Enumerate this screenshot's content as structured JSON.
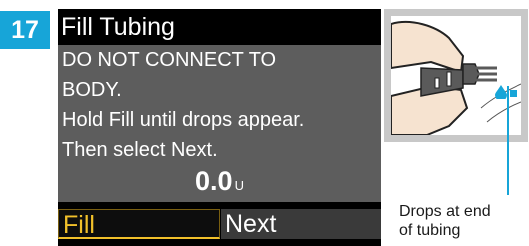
{
  "step": {
    "number": "17"
  },
  "screen": {
    "title": "Fill Tubing",
    "lines": [
      "DO NOT CONNECT TO",
      "BODY.",
      "Hold Fill until drops appear.",
      "Then select Next."
    ],
    "amount_value": "0.0",
    "amount_unit": "U",
    "softkeys": {
      "left": "Fill",
      "right": "Next"
    }
  },
  "callout": {
    "lines": [
      "Drops at end",
      "of tubing"
    ]
  },
  "colors": {
    "accent": "#17a5d8",
    "screen_bg": "#5d5d5d",
    "softkey_active": "#f1c02a"
  },
  "icons": {
    "illustration": "tubing-connector-illustration",
    "drop": "drop-icon"
  }
}
